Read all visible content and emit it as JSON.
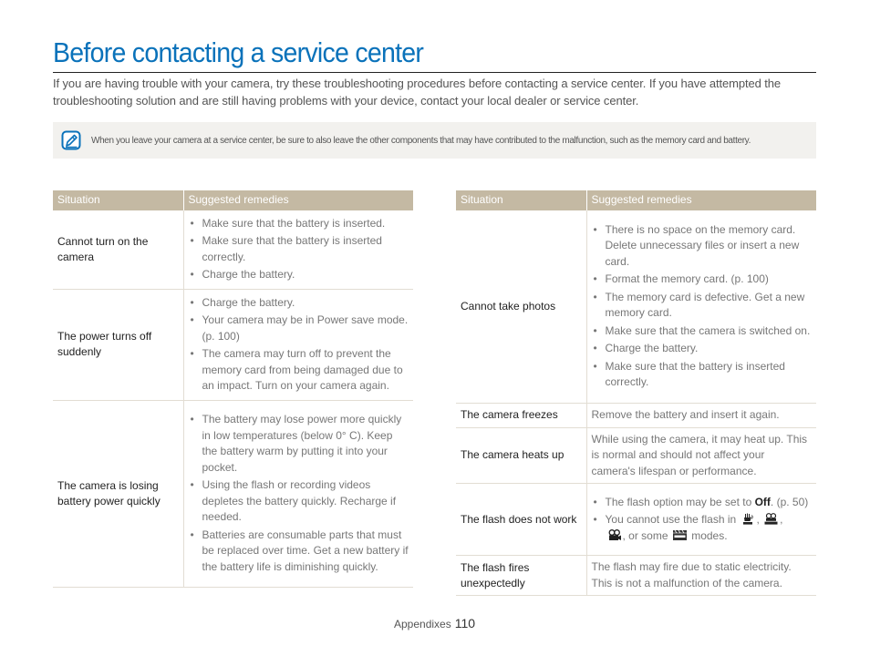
{
  "page": {
    "title": "Before contacting a service center",
    "intro": "If you are having trouble with your camera, try these troubleshooting procedures before contacting a service center. If you have attempted the troubleshooting solution and are still having problems with your device, contact your local dealer or service center.",
    "accent_color": "#0a72ba",
    "header_color": "#c4b9a3"
  },
  "note": {
    "icon": "note-pencil-icon",
    "text": "When you leave your camera at a service center, be sure to also leave the other components that may have contributed to the malfunction, such as the memory card and battery."
  },
  "table_left": {
    "headers": [
      "Situation",
      "Suggested remedies"
    ],
    "rows": [
      {
        "situation": "Cannot turn on the camera",
        "remedies": [
          "Make sure that the battery is inserted.",
          "Make sure that the battery is inserted correctly.",
          "Charge the battery."
        ]
      },
      {
        "situation": "The power turns off suddenly",
        "remedies": [
          "Charge the battery.",
          "Your camera may be in Power save mode. (p. 100)",
          "The camera may turn off to prevent the memory card from being damaged due to an impact. Turn on your camera again."
        ]
      },
      {
        "situation": "The camera is losing battery power quickly",
        "remedies": [
          "The battery may lose power more quickly in low temperatures (below 0° C). Keep the battery warm by putting it into your pocket.",
          "Using the flash or recording videos depletes the battery quickly. Recharge if needed.",
          "Batteries are consumable parts that must be replaced over time. Get a new battery if the battery life is diminishing quickly."
        ]
      }
    ]
  },
  "table_right": {
    "headers": [
      "Situation",
      "Suggested remedies"
    ],
    "rows": [
      {
        "situation": "Cannot take photos",
        "remedies": [
          "There is no space on the memory card. Delete unnecessary files or insert a new card.",
          "Format the memory card. (p. 100)",
          "The memory card is defective. Get a new memory card.",
          "Make sure that the camera is switched on.",
          "Charge the battery.",
          "Make sure that the battery is inserted correctly."
        ]
      },
      {
        "situation": "The camera freezes",
        "remedy_text": "Remove the battery and insert it again."
      },
      {
        "situation": "The camera heats up",
        "remedy_text": "While using the camera, it may heat up. This is normal and should not affect your camera's lifespan or performance."
      },
      {
        "situation": "The flash does not work",
        "remedy_1_pre": "The flash option may be set to ",
        "remedy_1_bold": "Off",
        "remedy_1_post": ". (p. 50)",
        "remedy_2_pre": "You cannot use the flash in ",
        "remedy_2_sep1": ", ",
        "remedy_2_sep2": ",",
        "remedy_2_mid": ", or some ",
        "remedy_2_post": " modes.",
        "mode_icons": [
          "dual-is-mode-icon",
          "smart-movie-mode-icon",
          "movie-mode-icon",
          "scene-mode-icon"
        ],
        "mode_icon_labels": [
          "DUAL",
          "SMART",
          "",
          "SCENE"
        ]
      },
      {
        "situation": "The flash fires unexpectedly",
        "remedy_text": "The flash may fire due to static electricity. This is not a malfunction of the camera."
      }
    ]
  },
  "footer": {
    "section": "Appendixes",
    "page_number": "110"
  }
}
